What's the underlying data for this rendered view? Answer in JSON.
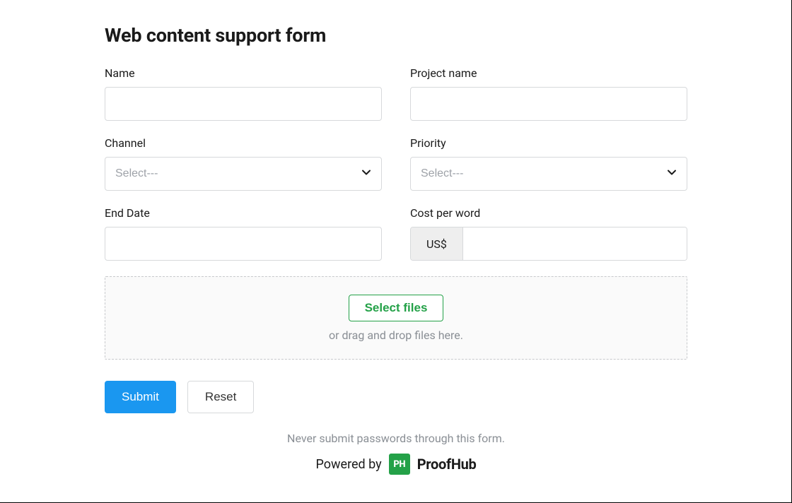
{
  "title": "Web content support form",
  "fields": {
    "name": {
      "label": "Name",
      "value": ""
    },
    "project_name": {
      "label": "Project name",
      "value": ""
    },
    "channel": {
      "label": "Channel",
      "placeholder": "Select---"
    },
    "priority": {
      "label": "Priority",
      "placeholder": "Select---"
    },
    "end_date": {
      "label": "End Date",
      "value": ""
    },
    "cost_per_word": {
      "label": "Cost per word",
      "prefix": "US$",
      "value": ""
    }
  },
  "upload": {
    "button": "Select files",
    "hint": "or drag and drop files here."
  },
  "actions": {
    "submit": "Submit",
    "reset": "Reset"
  },
  "footer": {
    "warning": "Never submit passwords through this form.",
    "powered_by": "Powered by",
    "brand_badge": "PH",
    "brand_name": "ProofHub"
  }
}
